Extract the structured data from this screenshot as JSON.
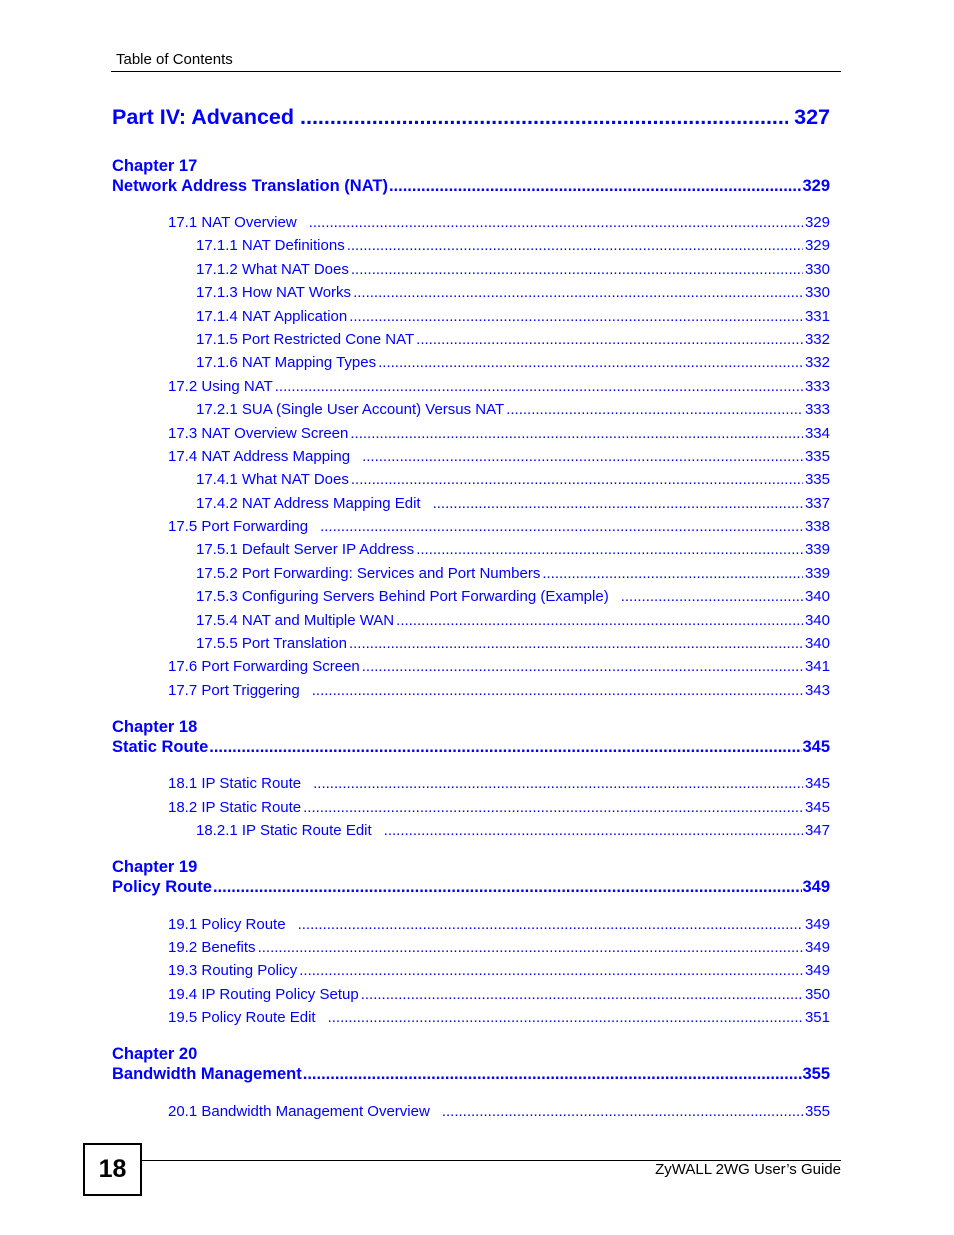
{
  "header": {
    "title": "Table of Contents"
  },
  "part": {
    "title": "Part IV: Advanced",
    "page": "327"
  },
  "chapters": [
    {
      "label": "Chapter  17",
      "title": "Network Address Translation (NAT)",
      "page": "329",
      "sections": [
        {
          "title": "17.1 NAT Overview",
          "page": "329",
          "level": 1
        },
        {
          "title": "17.1.1 NAT Definitions",
          "page": "329",
          "level": 2
        },
        {
          "title": "17.1.2 What NAT Does",
          "page": "330",
          "level": 2
        },
        {
          "title": "17.1.3 How NAT Works",
          "page": "330",
          "level": 2
        },
        {
          "title": "17.1.4 NAT Application",
          "page": "331",
          "level": 2
        },
        {
          "title": "17.1.5 Port Restricted Cone NAT",
          "page": "332",
          "level": 2
        },
        {
          "title": "17.1.6 NAT Mapping Types",
          "page": "332",
          "level": 2
        },
        {
          "title": "17.2 Using NAT",
          "page": "333",
          "level": 1
        },
        {
          "title": "17.2.1 SUA (Single User Account) Versus NAT",
          "page": "333",
          "level": 2
        },
        {
          "title": "17.3 NAT Overview Screen",
          "page": "334",
          "level": 1
        },
        {
          "title": "17.4 NAT Address Mapping",
          "page": "335",
          "level": 1
        },
        {
          "title": "17.4.1 What NAT Does",
          "page": "335",
          "level": 2
        },
        {
          "title": "17.4.2 NAT Address Mapping Edit",
          "page": "337",
          "level": 2
        },
        {
          "title": "17.5 Port Forwarding",
          "page": "338",
          "level": 1
        },
        {
          "title": "17.5.1 Default Server IP Address",
          "page": "339",
          "level": 2
        },
        {
          "title": "17.5.2 Port Forwarding: Services and Port Numbers",
          "page": "339",
          "level": 2
        },
        {
          "title": "17.5.3 Configuring Servers Behind Port Forwarding (Example)",
          "page": "340",
          "level": 2
        },
        {
          "title": "17.5.4 NAT and Multiple WAN",
          "page": "340",
          "level": 2
        },
        {
          "title": "17.5.5 Port Translation",
          "page": "340",
          "level": 2
        },
        {
          "title": "17.6 Port Forwarding Screen",
          "page": "341",
          "level": 1
        },
        {
          "title": "17.7 Port Triggering",
          "page": "343",
          "level": 1
        }
      ]
    },
    {
      "label": "Chapter  18",
      "title": "Static Route",
      "page": "345",
      "sections": [
        {
          "title": "18.1 IP Static Route",
          "page": "345",
          "level": 1
        },
        {
          "title": "18.2 IP Static Route",
          "page": "345",
          "level": 1
        },
        {
          "title": "18.2.1 IP Static Route Edit",
          "page": "347",
          "level": 2
        }
      ]
    },
    {
      "label": "Chapter  19",
      "title": "Policy Route",
      "page": "349",
      "sections": [
        {
          "title": "19.1 Policy Route",
          "page": "349",
          "level": 1
        },
        {
          "title": "19.2 Benefits",
          "page": "349",
          "level": 1
        },
        {
          "title": "19.3 Routing Policy",
          "page": "349",
          "level": 1
        },
        {
          "title": "19.4 IP Routing Policy Setup",
          "page": "350",
          "level": 1
        },
        {
          "title": "19.5 Policy Route Edit",
          "page": "351",
          "level": 1
        }
      ]
    },
    {
      "label": "Chapter  20",
      "title": "Bandwidth Management",
      "page": "355",
      "sections": [
        {
          "title": "20.1 Bandwidth Management Overview",
          "page": "355",
          "level": 1
        }
      ]
    }
  ],
  "footer": {
    "page_number": "18",
    "guide_title": "ZyWALL 2WG User’s Guide"
  }
}
